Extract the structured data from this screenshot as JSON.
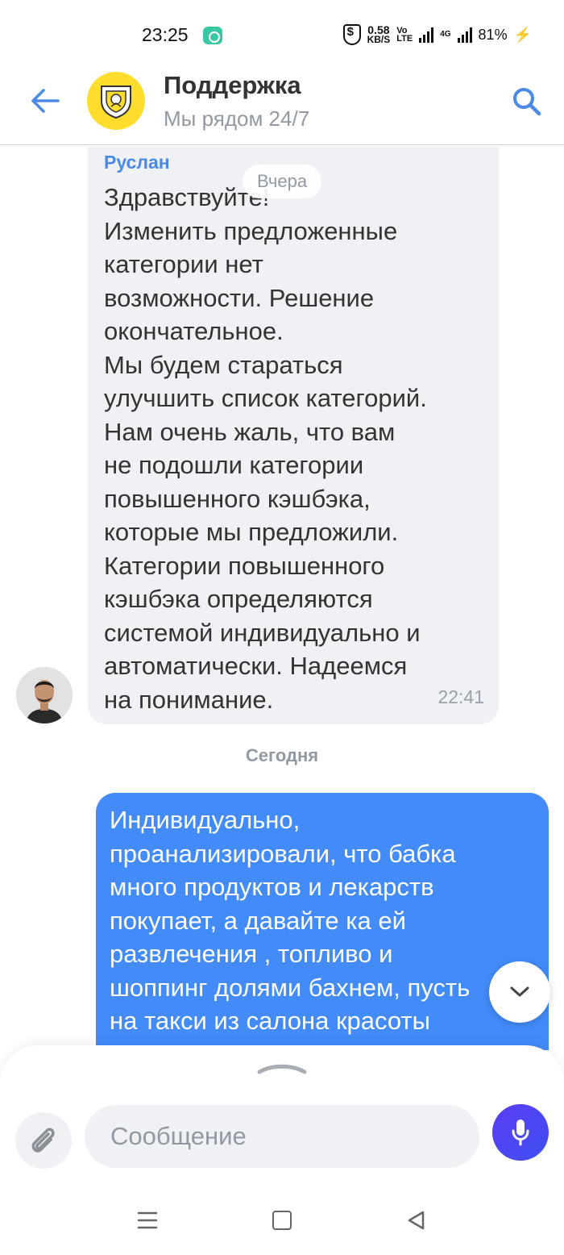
{
  "status_bar": {
    "time": "23:25",
    "net_speed_value": "0.58",
    "net_speed_unit": "KB/S",
    "volte_top": "Vo",
    "volte_bottom": "LTE",
    "network_type": "4G",
    "battery": "81%"
  },
  "header": {
    "title": "Поддержка",
    "subtitle": "Мы рядом 24/7",
    "brand_color": "#ffdd2d",
    "accent_color": "#4a8ae6"
  },
  "chat": {
    "date_yesterday": "Вчера",
    "incoming": {
      "sender": "Руслан",
      "text": "Здравствуйте!\nИзменить предложенные\nкатегории нет\nвозможности. Решение\nокончательное.\nМы будем стараться\nулучшить список категорий.\nНам очень жаль, что вам\nне подошли категории\nповышенного кэшбэка,\nкоторые мы предложили.\nКатегории повышенного\nкэшбэка определяются\nсистемой индивидуально и\nавтоматически. Надеемся\nна понимание.",
      "time": "22:41"
    },
    "date_today": "Сегодня",
    "outgoing": {
      "text": "Индивидуально,\nпроанализировали, что бабка\nмного продуктов и лекарств\nпокупает, а давайте ка ей\nразвлечения , топливо и\nшоппинг долями бахнем, пусть\nна такси из салона красоты\nездит",
      "color": "#428bf9"
    }
  },
  "composer": {
    "placeholder": "Сообщение",
    "value": "",
    "mic_color": "#4a3ff5"
  },
  "icons": [
    "back-arrow-icon",
    "search-icon",
    "chevron-down-icon",
    "paperclip-icon",
    "microphone-icon",
    "chevron-up-icon"
  ]
}
